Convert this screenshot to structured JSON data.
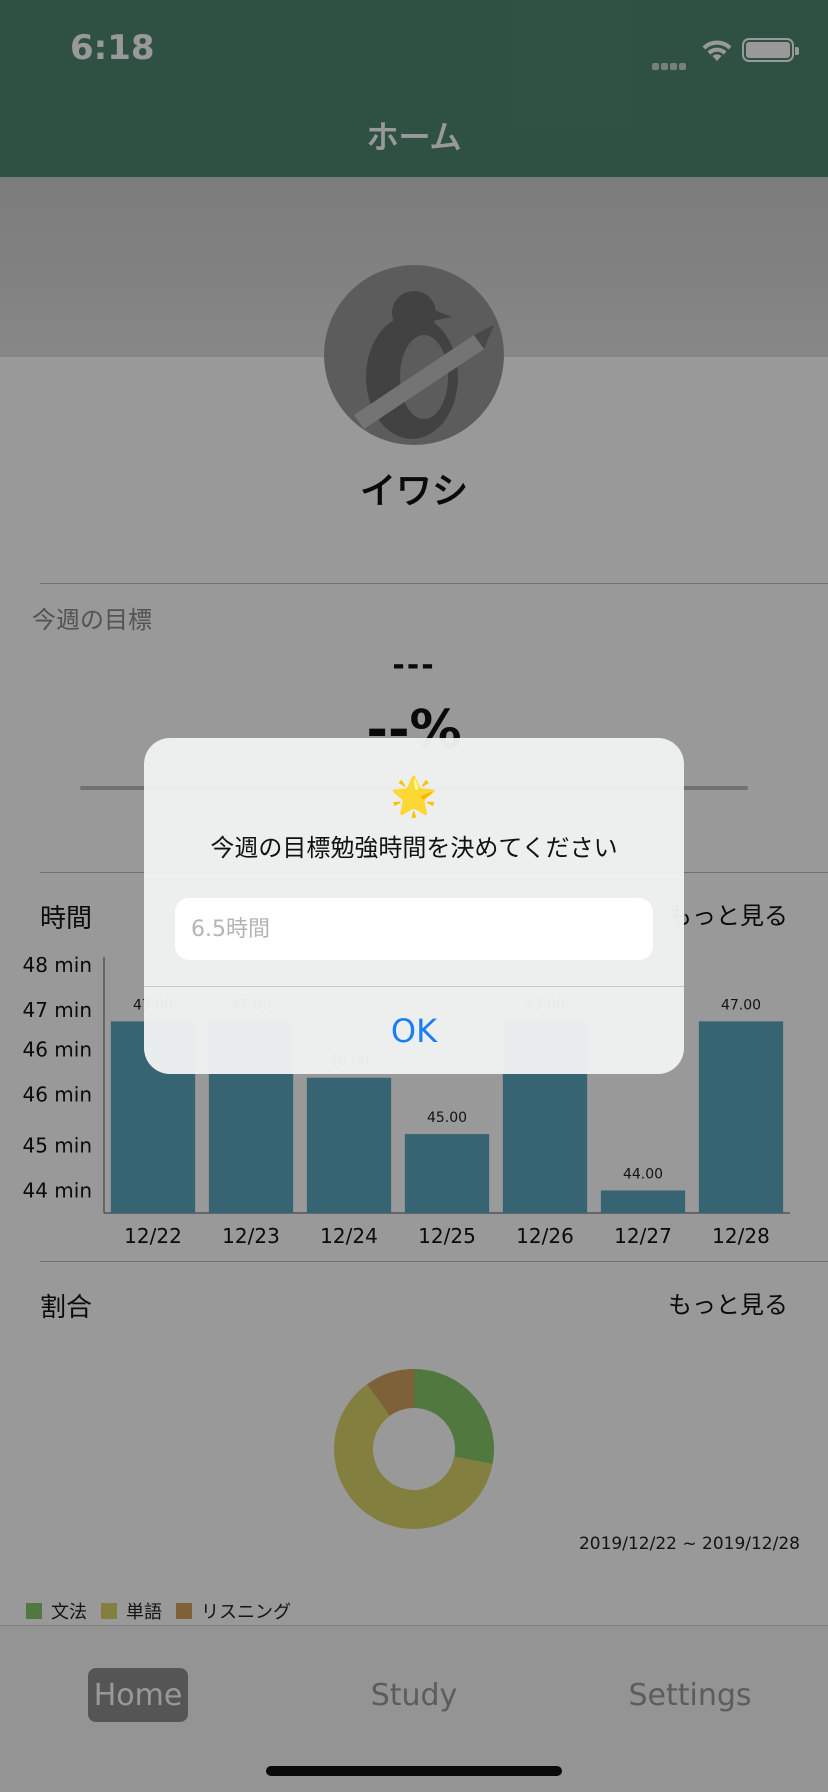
{
  "status_bar": {
    "time": "6:18"
  },
  "nav": {
    "title": "ホーム"
  },
  "profile": {
    "name": "イワシ"
  },
  "goal": {
    "label": "今週の目標",
    "value": "---",
    "percent": "--%"
  },
  "time_section": {
    "title": "時間",
    "more": "もっと見る"
  },
  "ratio_section": {
    "title": "割合",
    "more": "もっと見る",
    "date_range": "2019/12/22 ~ 2019/12/28"
  },
  "tabs": [
    {
      "label": "Home",
      "selected": true
    },
    {
      "label": "Study",
      "selected": false
    },
    {
      "label": "Settings",
      "selected": false
    }
  ],
  "alert": {
    "icon": "🌟",
    "message": "今週の目標勉強時間を決めてください",
    "input_placeholder": "6.5時間",
    "ok_label": "OK"
  },
  "colors": {
    "nav": "#4e8872",
    "bar": "#5aa7c0",
    "accent": "#1a7ef4",
    "grammar": "#86c86a",
    "vocabulary": "#d9d46a",
    "listening": "#d2a05f"
  },
  "chart_data": [
    {
      "type": "bar",
      "categories": [
        "12/22",
        "12/23",
        "12/24",
        "12/25",
        "12/26",
        "12/27",
        "12/28"
      ],
      "values": [
        47.0,
        47.0,
        46.0,
        45.0,
        47.0,
        44.0,
        47.0
      ],
      "data_labels": [
        "47.00",
        "47.00",
        "46.00",
        "45.00",
        "47.00",
        "44.00",
        "47.00"
      ],
      "y_ticks": [
        "44 min",
        "45 min",
        "46 min",
        "46 min",
        "47 min",
        "48 min"
      ],
      "ylim": [
        43.6,
        48.0
      ],
      "grid": false
    },
    {
      "type": "pie",
      "donut": true,
      "labels": [
        "文法",
        "単語",
        "リスニング"
      ],
      "values": [
        28,
        62,
        10
      ],
      "legend": "bottom-left"
    }
  ]
}
